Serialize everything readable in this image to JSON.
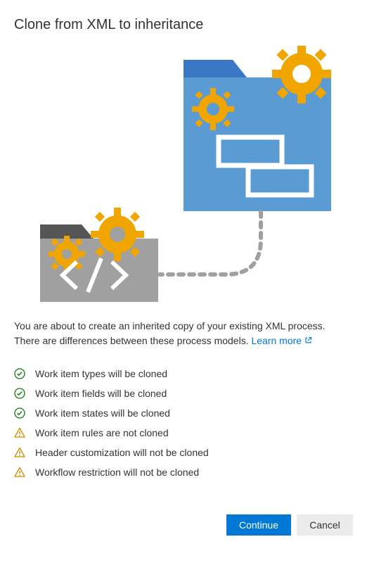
{
  "dialog": {
    "title": "Clone from XML to inheritance",
    "description_before": "You are about to create an inherited copy of your existing XML process. There are differences between these process models. ",
    "learn_more_label": "Learn more"
  },
  "items": [
    {
      "status": "ok",
      "label": "Work item types will be cloned"
    },
    {
      "status": "ok",
      "label": "Work item fields will be cloned"
    },
    {
      "status": "ok",
      "label": "Work item states will be cloned"
    },
    {
      "status": "warn",
      "label": "Work item rules are not cloned"
    },
    {
      "status": "warn",
      "label": "Header customization will not be cloned"
    },
    {
      "status": "warn",
      "label": "Workflow restriction will not be cloned"
    }
  ],
  "buttons": {
    "continue": "Continue",
    "cancel": "Cancel"
  },
  "icons": {
    "ok": "check-circle-icon",
    "warn": "warning-triangle-icon"
  }
}
